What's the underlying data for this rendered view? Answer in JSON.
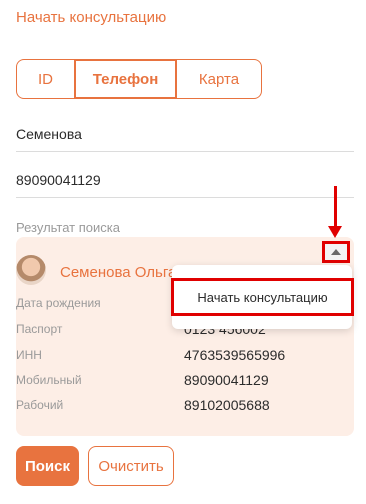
{
  "header": {
    "title": "Начать консультацию"
  },
  "tabs": [
    {
      "label": "ID"
    },
    {
      "label": "Телефон"
    },
    {
      "label": "Карта"
    }
  ],
  "fields": {
    "surname": "Семенова",
    "phone": "89090041129"
  },
  "result": {
    "label": "Результат поиска",
    "name": "Семенова Ольга",
    "rows": [
      {
        "label": "Дата рождения",
        "value": ""
      },
      {
        "label": "Паспорт",
        "value": "0123 456002"
      },
      {
        "label": "ИНН",
        "value": "4763539565996"
      },
      {
        "label": "Мобильный",
        "value": "89090041129"
      },
      {
        "label": "Рабочий",
        "value": "89102005688"
      }
    ]
  },
  "dropdown": {
    "item_label": "Начать консультацию"
  },
  "buttons": {
    "search": "Поиск",
    "clear": "Очистить"
  },
  "colors": {
    "accent": "#e8733f",
    "card_bg": "#fdeee6",
    "annotation": "#e00000"
  },
  "icons": {
    "toggle": "caret-up-icon",
    "avatar": "user-avatar"
  }
}
